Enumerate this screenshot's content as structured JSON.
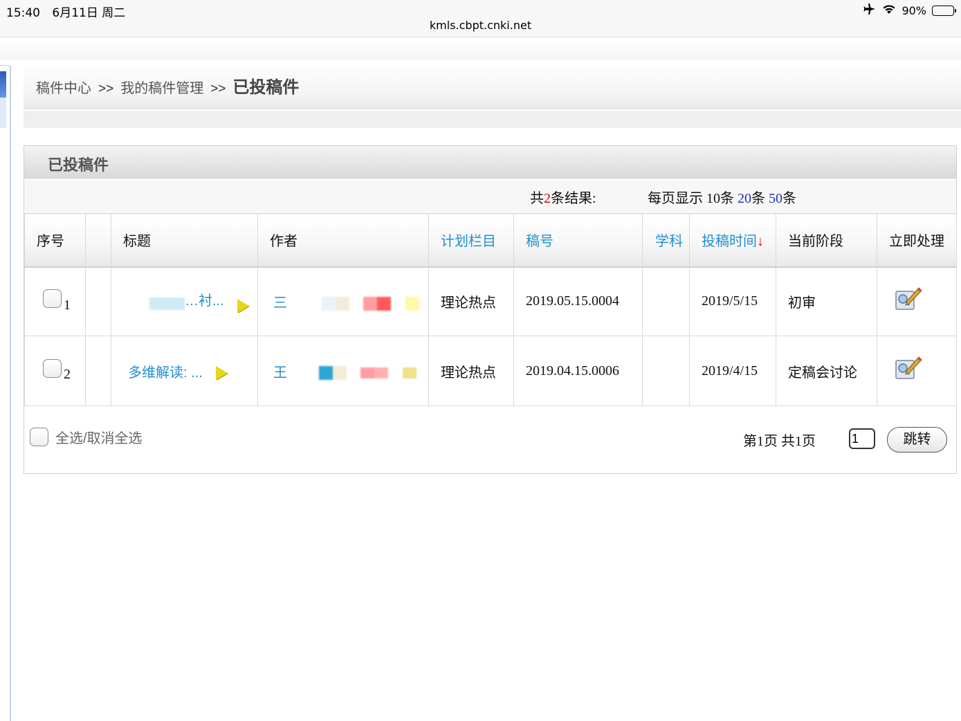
{
  "status_bar": {
    "time": "15:40",
    "date": "6月11日 周二",
    "battery": "90%",
    "battery_level": 0.9,
    "url": "kmls.cbpt.cnki.net"
  },
  "breadcrumb": {
    "items": [
      "稿件中心",
      "我的稿件管理"
    ],
    "separator": ">>",
    "current": "已投稿件"
  },
  "panel": {
    "title": "已投稿件",
    "summary": {
      "total_prefix": "共",
      "total_count": "2",
      "total_suffix": "条结果:",
      "per_page_label": "每页显示 10条 ",
      "option_20": "20",
      "unit_20": "条 ",
      "option_50": "50",
      "unit_50": "条"
    }
  },
  "table": {
    "columns": [
      "序号",
      "",
      "标题",
      "作者",
      "计划栏目",
      "稿号",
      "学科",
      "投稿时间",
      "当前阶段",
      "立即处理"
    ],
    "sort_arrow": "↓",
    "rows": [
      {
        "seq": "1",
        "title": "…衬...",
        "author": "三",
        "column": "理论热点",
        "manuscript_no": "2019.05.15.0004",
        "subject": "",
        "submit_date": "2019/5/15",
        "stage": "初审"
      },
      {
        "seq": "2",
        "title": "多维解读: ...",
        "author": "王",
        "column": "理论热点",
        "manuscript_no": "2019.04.15.0006",
        "subject": "",
        "submit_date": "2019/4/15",
        "stage": "定稿会讨论"
      }
    ]
  },
  "footer": {
    "select_all_label": "全选/取消全选",
    "pager_text": "第1页 共1页",
    "page_input_value": "1",
    "jump_label": "跳转"
  },
  "colors": {
    "link": "#1f8fd0",
    "accent_red": "#e00000",
    "accent_blue": "#1c2fb0"
  },
  "icons": [
    "airplane-icon",
    "wifi-icon",
    "battery-icon",
    "play-arrow-icon",
    "edit-icon"
  ]
}
